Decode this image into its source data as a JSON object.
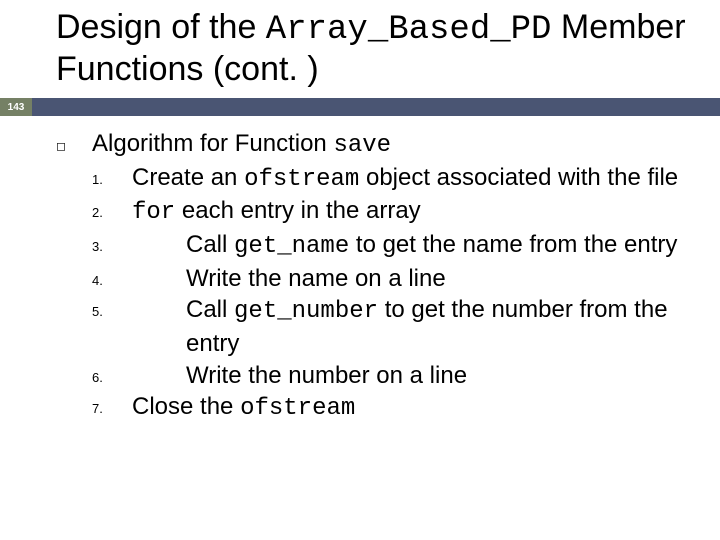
{
  "page_number": "143",
  "title": {
    "pre1": "Design of the ",
    "code1": "Array_Based_PD",
    "post1": " Member Functions (cont. )"
  },
  "lines": [
    {
      "kind": "head",
      "pre": "Algorithm for Function ",
      "code": "save",
      "post": ""
    },
    {
      "kind": "step",
      "num": "1.",
      "indent": 1,
      "pre": "Create an ",
      "code": "ofstream",
      "post": " object associated with the file"
    },
    {
      "kind": "step",
      "num": "2.",
      "indent": 1,
      "precode": "for",
      "post": " each entry in the array"
    },
    {
      "kind": "step",
      "num": "3.",
      "indent": 2,
      "pre": "Call ",
      "code": "get_name",
      "post": " to get the name from the entry"
    },
    {
      "kind": "step",
      "num": "4.",
      "indent": 2,
      "pre": "Write the name on a line"
    },
    {
      "kind": "step",
      "num": "5.",
      "indent": 2,
      "pre": "Call ",
      "code": "get_number",
      "post": " to get the number from the entry"
    },
    {
      "kind": "step",
      "num": "6.",
      "indent": 2,
      "pre": "Write the number on a line"
    },
    {
      "kind": "step",
      "num": "7.",
      "indent": 1,
      "pre": "Close the ",
      "code": "ofstream",
      "post": ""
    }
  ]
}
